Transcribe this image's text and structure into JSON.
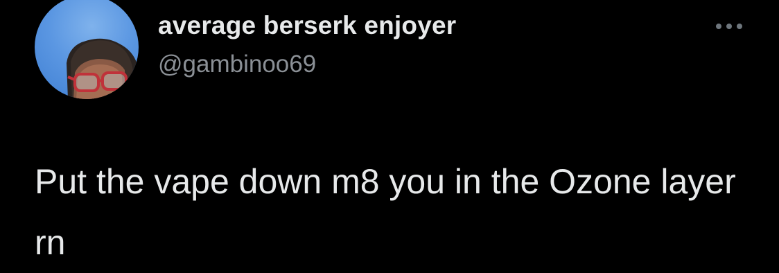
{
  "tweet": {
    "author": {
      "display_name": "average berserk enjoyer",
      "handle": "@gambinoo69",
      "avatar_icon": "profile-photo"
    },
    "more_icon": "ellipsis-icon",
    "text": "Put the vape down m8 you in the Ozone layer rn"
  },
  "colors": {
    "background": "#000000",
    "primary_text": "#e7e9ea",
    "secondary_text": "#8b9096"
  }
}
